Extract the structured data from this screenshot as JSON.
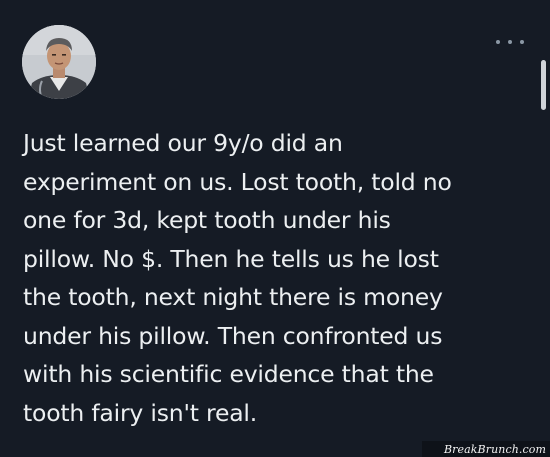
{
  "tweet": {
    "avatar_icon": "profile-avatar-icon",
    "more_icon": "more-options-icon",
    "text_lines": [
      "Just learned our 9y/o did an",
      "experiment on us.  Lost tooth, told no",
      "one for 3d, kept tooth under his",
      "pillow.  No $.  Then he tells us he lost",
      "the tooth, next night there is money",
      "under his pillow.  Then confronted us",
      "with his scientific evidence that the",
      "tooth fairy isn't real."
    ]
  },
  "watermark": {
    "text": "BreakBrunch.com"
  },
  "colors": {
    "background": "#151b25",
    "text": "#eceff1",
    "icon": "#8b98a5"
  }
}
